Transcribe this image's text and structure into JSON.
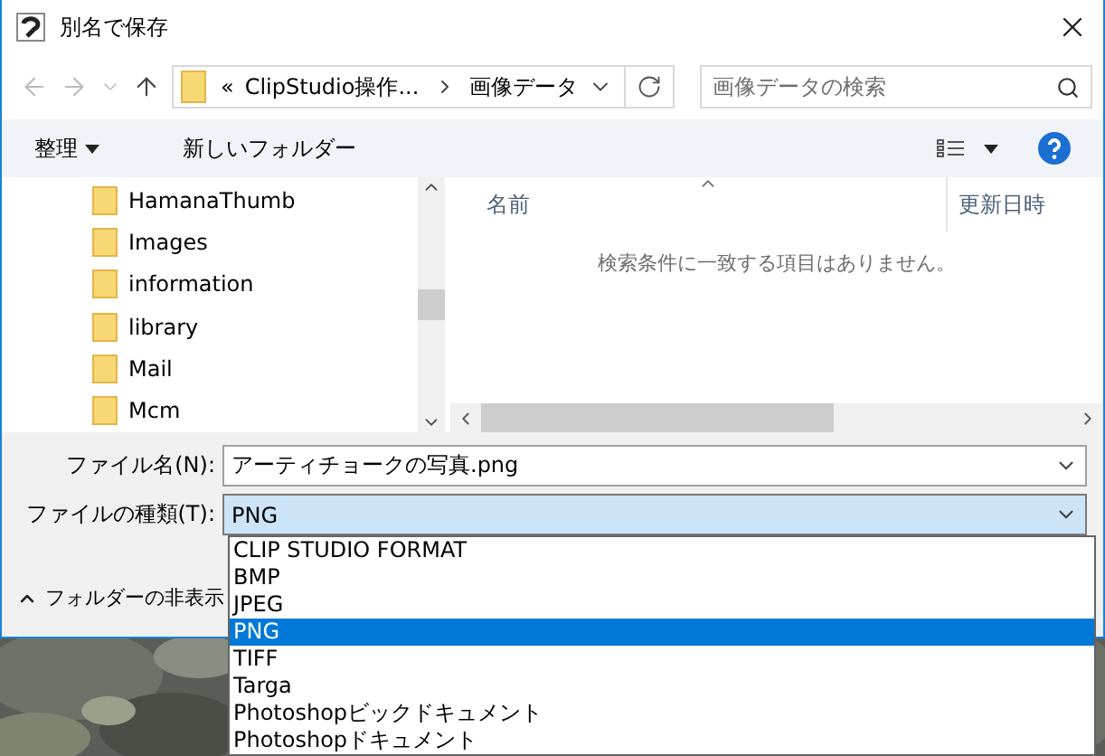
{
  "window": {
    "title": "別名で保存"
  },
  "address": {
    "overflow": "«",
    "segments": [
      "ClipStudio操作...",
      "画像データ"
    ]
  },
  "search": {
    "placeholder": "画像データの検索"
  },
  "toolbar": {
    "organize": "整理",
    "new_folder": "新しいフォルダー"
  },
  "tree": {
    "items": [
      {
        "name": "HamanaThumb"
      },
      {
        "name": "Images"
      },
      {
        "name": "information"
      },
      {
        "name": "library"
      },
      {
        "name": "Mail"
      },
      {
        "name": "Mcm"
      }
    ]
  },
  "list": {
    "columns": [
      "名前",
      "更新日時"
    ],
    "empty_message": "検索条件に一致する項目はありません。"
  },
  "file_name": {
    "label": "ファイル名(N):",
    "value": "アーティチョークの写真.png"
  },
  "file_type": {
    "label": "ファイルの種類(T):",
    "value": "PNG",
    "options": [
      {
        "label": "CLIP STUDIO FORMAT",
        "selected": false
      },
      {
        "label": "BMP",
        "selected": false
      },
      {
        "label": "JPEG",
        "selected": false
      },
      {
        "label": "PNG",
        "selected": true
      },
      {
        "label": "TIFF",
        "selected": false
      },
      {
        "label": "Targa",
        "selected": false
      },
      {
        "label": "Photoshopビックドキュメント",
        "selected": false
      },
      {
        "label": "Photoshopドキュメント",
        "selected": false
      }
    ]
  },
  "hide_folders": "フォルダーの非表示"
}
